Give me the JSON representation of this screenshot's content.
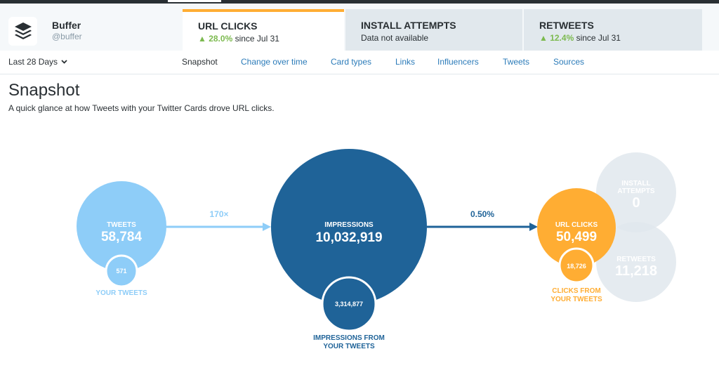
{
  "account": {
    "name": "Buffer",
    "handle": "@buffer"
  },
  "metric_tabs": [
    {
      "title": "URL CLICKS",
      "change": "▲ 28.0%",
      "since": " since Jul 31",
      "active": true
    },
    {
      "title": "INSTALL ATTEMPTS",
      "change": "",
      "since": "Data not available",
      "active": false
    },
    {
      "title": "RETWEETS",
      "change": "▲ 12.4%",
      "since": " since Jul 31",
      "active": false
    }
  ],
  "date_range": {
    "label": "Last 28 Days"
  },
  "subnav": [
    "Snapshot",
    "Change over time",
    "Card types",
    "Links",
    "Influencers",
    "Tweets",
    "Sources"
  ],
  "page": {
    "title": "Snapshot",
    "description": "A quick glance at how Tweets with your Twitter Cards drove URL clicks."
  },
  "colors": {
    "tweets": "#8ecdf8",
    "impressions": "#1f6398",
    "url_clicks": "#ffad33",
    "inactive": "#e1e8ed",
    "accent_tab": "#ffad33",
    "positive": "#7cba4f",
    "link": "#2b7bb9"
  },
  "funnel": {
    "tweets": {
      "label": "TWEETS",
      "value": "58,784",
      "sub_value": "571",
      "sub_label": "YOUR TWEETS"
    },
    "ratio_1": "170×",
    "impressions": {
      "label": "IMPRESSIONS",
      "value": "10,032,919",
      "sub_value": "3,314,877",
      "sub_label_1": "IMPRESSIONS FROM",
      "sub_label_2": "YOUR TWEETS"
    },
    "ratio_2": "0.50%",
    "url_clicks": {
      "label": "URL CLICKS",
      "value": "50,499",
      "sub_value": "18,726",
      "sub_label_1": "CLICKS FROM",
      "sub_label_2": "YOUR TWEETS"
    },
    "install_attempts": {
      "label_1": "INSTALL",
      "label_2": "ATTEMPTS",
      "value": "0"
    },
    "retweets": {
      "label": "RETWEETS",
      "value": "11,218"
    }
  }
}
